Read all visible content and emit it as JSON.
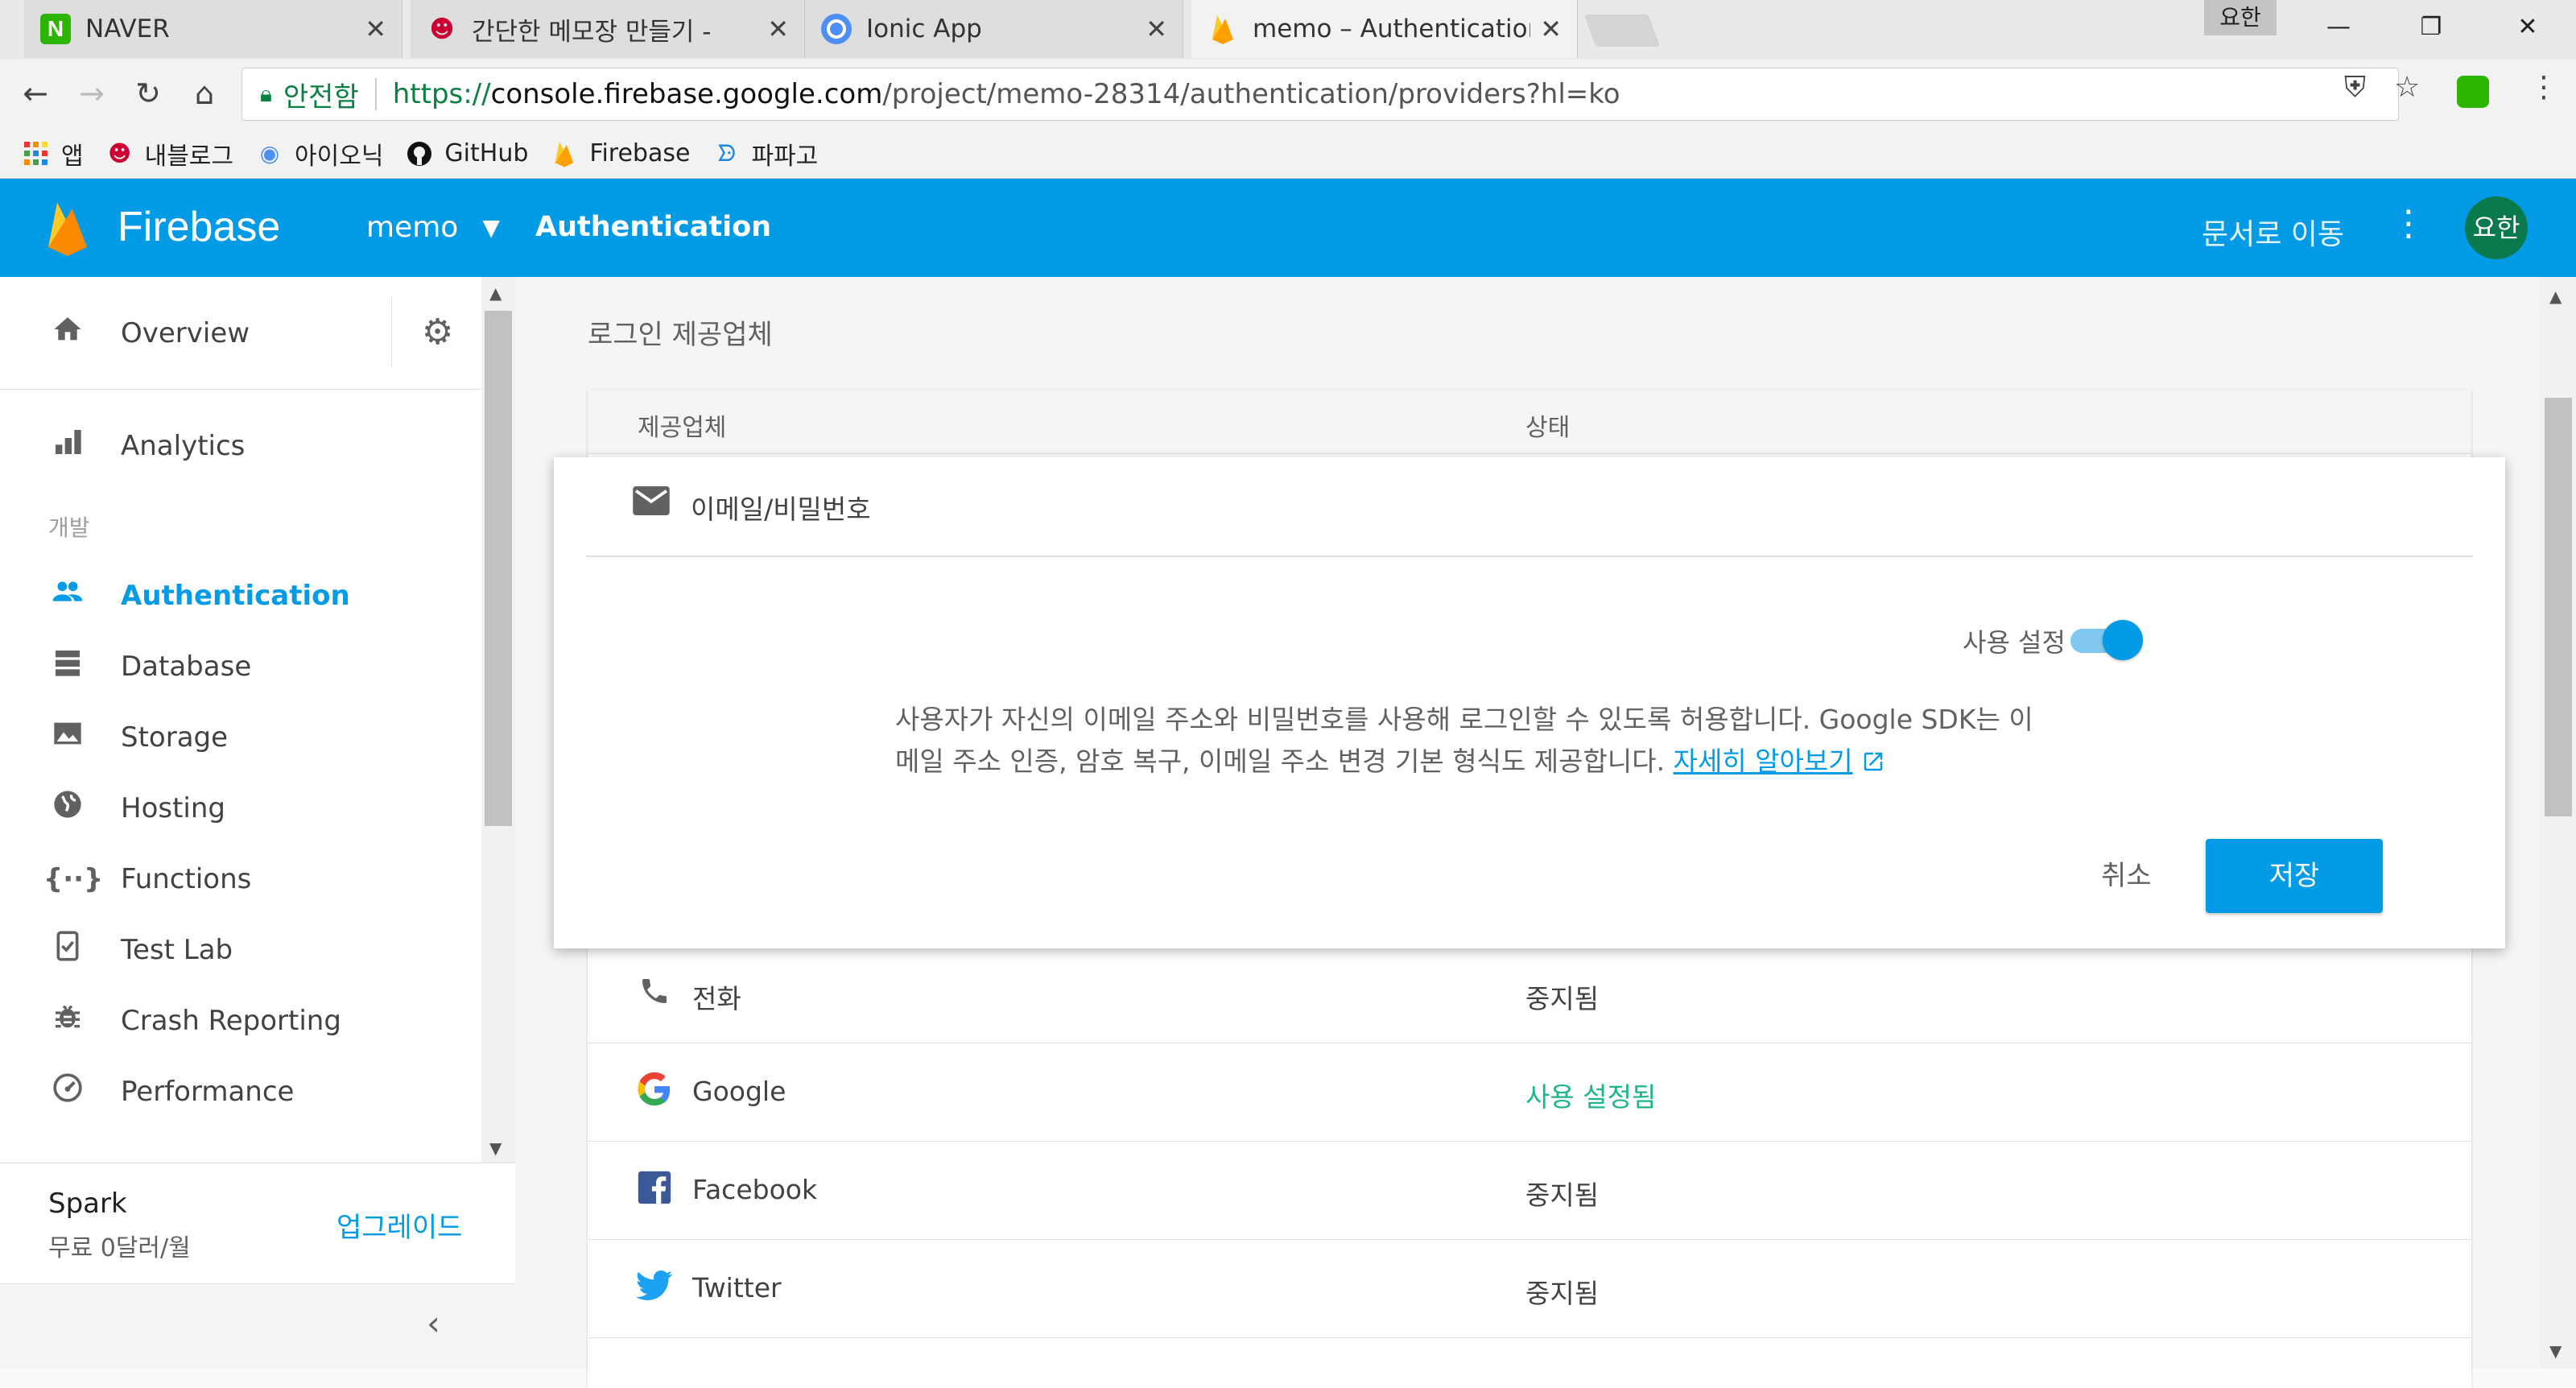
{
  "browser": {
    "tabs": [
      {
        "title": "NAVER",
        "icon": "naver-icon"
      },
      {
        "title": "간단한 메모장 만들기 - ",
        "icon": "blog-icon"
      },
      {
        "title": "Ionic App",
        "icon": "ionic-icon"
      },
      {
        "title": "memo – Authentication",
        "icon": "firebase-icon"
      }
    ],
    "profile_label": "요한",
    "security_label": "안전함",
    "url_proto": "https://",
    "url_host": "console.firebase.google.com",
    "url_path": "/project/memo-28314/authentication/providers?hl=ko",
    "bookmarks": [
      "앱",
      "내블로그",
      "아이오닉",
      "GitHub",
      "Firebase",
      "파파고"
    ]
  },
  "header": {
    "brand": "Firebase",
    "project": "memo",
    "section": "Authentication",
    "docs_link": "문서로 이동",
    "avatar": "요한",
    "bg_color": "#039be5"
  },
  "sidebar": {
    "overview": "Overview",
    "analytics": "Analytics",
    "dev_group": "개발",
    "items": [
      {
        "label": "Authentication",
        "icon": "people-icon",
        "active": true
      },
      {
        "label": "Database",
        "icon": "database-icon"
      },
      {
        "label": "Storage",
        "icon": "storage-icon"
      },
      {
        "label": "Hosting",
        "icon": "globe-icon"
      },
      {
        "label": "Functions",
        "icon": "functions-icon"
      },
      {
        "label": "Test Lab",
        "icon": "testlab-icon"
      },
      {
        "label": "Crash Reporting",
        "icon": "bug-icon"
      },
      {
        "label": "Performance",
        "icon": "speedometer-icon"
      }
    ],
    "plan_name": "Spark",
    "plan_price": "무료 0달러/월",
    "upgrade": "업그레이드"
  },
  "main": {
    "heading": "로그인 제공업체",
    "col_provider": "제공업체",
    "col_status": "상태",
    "email_panel": {
      "title": "이메일/비밀번호",
      "enable_label": "사용 설정",
      "enabled": true,
      "description_line1": "사용자가 자신의 이메일 주소와 비밀번호를 사용해 로그인할 수 있도록 허용합니다. Google SDK는 이",
      "description_line2": "메일 주소 인증, 암호 복구, 이메일 주소 변경 기본 형식도 제공합니다. ",
      "learn_more": "자세히 알아보기",
      "cancel": "취소",
      "save": "저장"
    },
    "providers": [
      {
        "name": "전화",
        "status": "중지됨",
        "icon": "phone-icon"
      },
      {
        "name": "Google",
        "status": "사용 설정됨",
        "icon": "google-icon"
      },
      {
        "name": "Facebook",
        "status": "중지됨",
        "icon": "facebook-icon"
      },
      {
        "name": "Twitter",
        "status": "중지됨",
        "icon": "twitter-icon"
      }
    ],
    "enabled_color": "#1db58a"
  }
}
